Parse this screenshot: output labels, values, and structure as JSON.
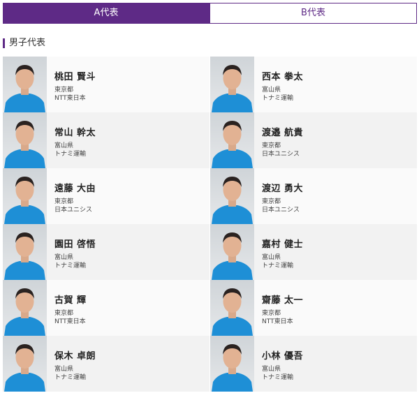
{
  "tabs": [
    {
      "label": "A代表",
      "active": true
    },
    {
      "label": "B代表",
      "active": false
    }
  ],
  "section": {
    "title": "男子代表"
  },
  "players": [
    {
      "name": "桃田 賢斗",
      "prefecture": "東京都",
      "team": "NTT東日本"
    },
    {
      "name": "西本 拳太",
      "prefecture": "富山県",
      "team": "トナミ運輸"
    },
    {
      "name": "常山 幹太",
      "prefecture": "富山県",
      "team": "トナミ運輸"
    },
    {
      "name": "渡邉 航貴",
      "prefecture": "東京都",
      "team": "日本ユニシス"
    },
    {
      "name": "遠藤 大由",
      "prefecture": "東京都",
      "team": "日本ユニシス"
    },
    {
      "name": "渡辺 勇大",
      "prefecture": "東京都",
      "team": "日本ユニシス"
    },
    {
      "name": "園田 啓悟",
      "prefecture": "富山県",
      "team": "トナミ運輸"
    },
    {
      "name": "嘉村 健士",
      "prefecture": "富山県",
      "team": "トナミ運輸"
    },
    {
      "name": "古賀 輝",
      "prefecture": "東京都",
      "team": "NTT東日本"
    },
    {
      "name": "齋藤 太一",
      "prefecture": "東京都",
      "team": "NTT東日本"
    },
    {
      "name": "保木 卓朗",
      "prefecture": "富山県",
      "team": "トナミ運輸"
    },
    {
      "name": "小林 優吾",
      "prefecture": "富山県",
      "team": "トナミ運輸"
    }
  ],
  "colors": {
    "accent": "#5e2a86",
    "jersey": "#1e8fd6",
    "row_shade": "#f2f2f2"
  }
}
